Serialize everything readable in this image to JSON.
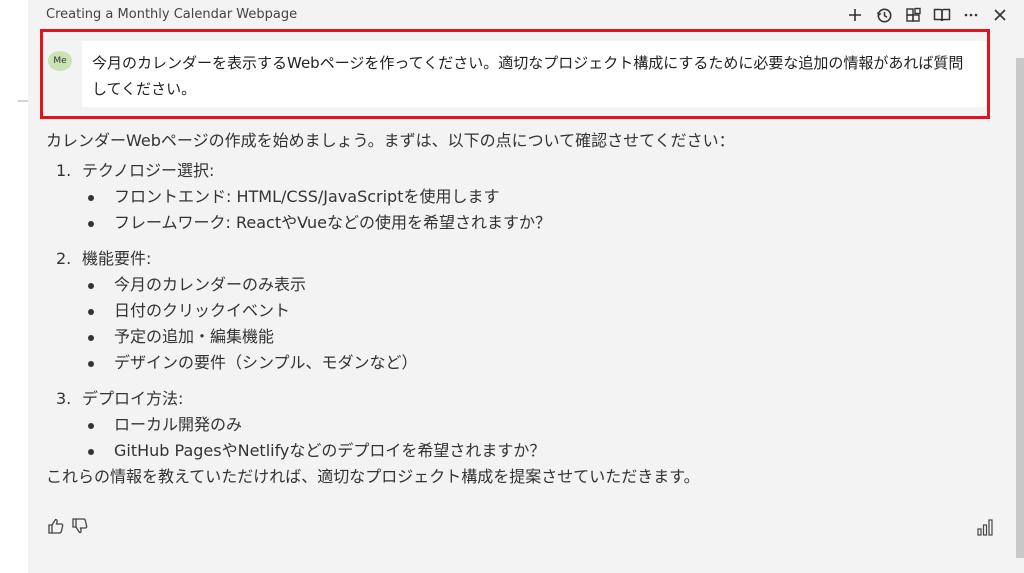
{
  "window": {
    "title": "Creating a Monthly Calendar Webpage",
    "toolbar": [
      {
        "name": "new-chat",
        "icon": "plus-icon"
      },
      {
        "name": "history",
        "icon": "history-icon"
      },
      {
        "name": "extensions",
        "icon": "grid-icon"
      },
      {
        "name": "docs",
        "icon": "book-icon"
      },
      {
        "name": "more",
        "icon": "ellipsis-icon",
        "label": "···"
      },
      {
        "name": "close",
        "icon": "close-icon",
        "label": "✕"
      }
    ]
  },
  "user_message": {
    "avatar": "Me",
    "text": "今月のカレンダーを表示するWebページを作ってください。適切なプロジェクト構成にするために必要な追加の情報があれば質問してください。",
    "highlight_color": "#e0141e"
  },
  "reply": {
    "intro": "カレンダーWebページの作成を始めましょう。まずは、以下の点について確認させてください：",
    "sections": [
      {
        "num": "1.",
        "title": "テクノロジー選択:",
        "items": [
          "フロントエンド: HTML/CSS/JavaScriptを使用します",
          "フレームワーク: ReactやVueなどの使用を希望されますか？"
        ]
      },
      {
        "num": "2.",
        "title": "機能要件:",
        "items": [
          "今月のカレンダーのみ表示",
          "日付のクリックイベント",
          "予定の追加・編集機能",
          "デザインの要件（シンプル、モダンなど）"
        ]
      },
      {
        "num": "3.",
        "title": "デプロイ方法:",
        "items": [
          "ローカル開発のみ",
          "GitHub PagesやNetlifyなどのデプロイを希望されますか？"
        ]
      }
    ],
    "outro": "これらの情報を教えていただければ、適切なプロジェクト構成を提案させていただきます。"
  },
  "feedback": {
    "like_icon": "thumbs-up-icon",
    "dislike_icon": "thumbs-down-icon",
    "stats_icon": "bar-chart-icon"
  }
}
